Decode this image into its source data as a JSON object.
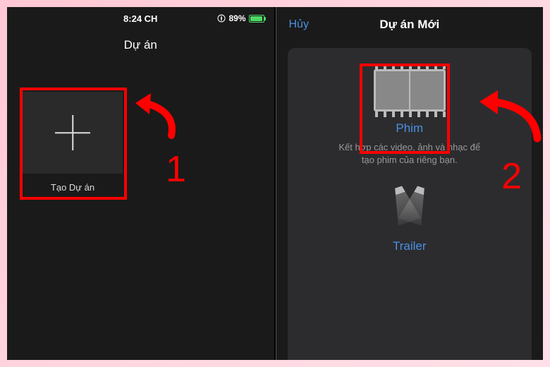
{
  "statusBar": {
    "time": "8:24 CH",
    "battery": "89%"
  },
  "panel1": {
    "title": "Dự án",
    "createLabel": "Tạo Dự án",
    "stepNumber": "1"
  },
  "panel2": {
    "cancel": "Hủy",
    "title": "Dự án Mới",
    "phim": {
      "title": "Phim",
      "desc": "Kết hợp các video, ảnh và nhạc để tạo phim của riêng bạn."
    },
    "trailer": {
      "title": "Trailer"
    },
    "stepNumber": "2"
  },
  "colors": {
    "highlight": "#ff0000",
    "link": "#4a90e2"
  }
}
